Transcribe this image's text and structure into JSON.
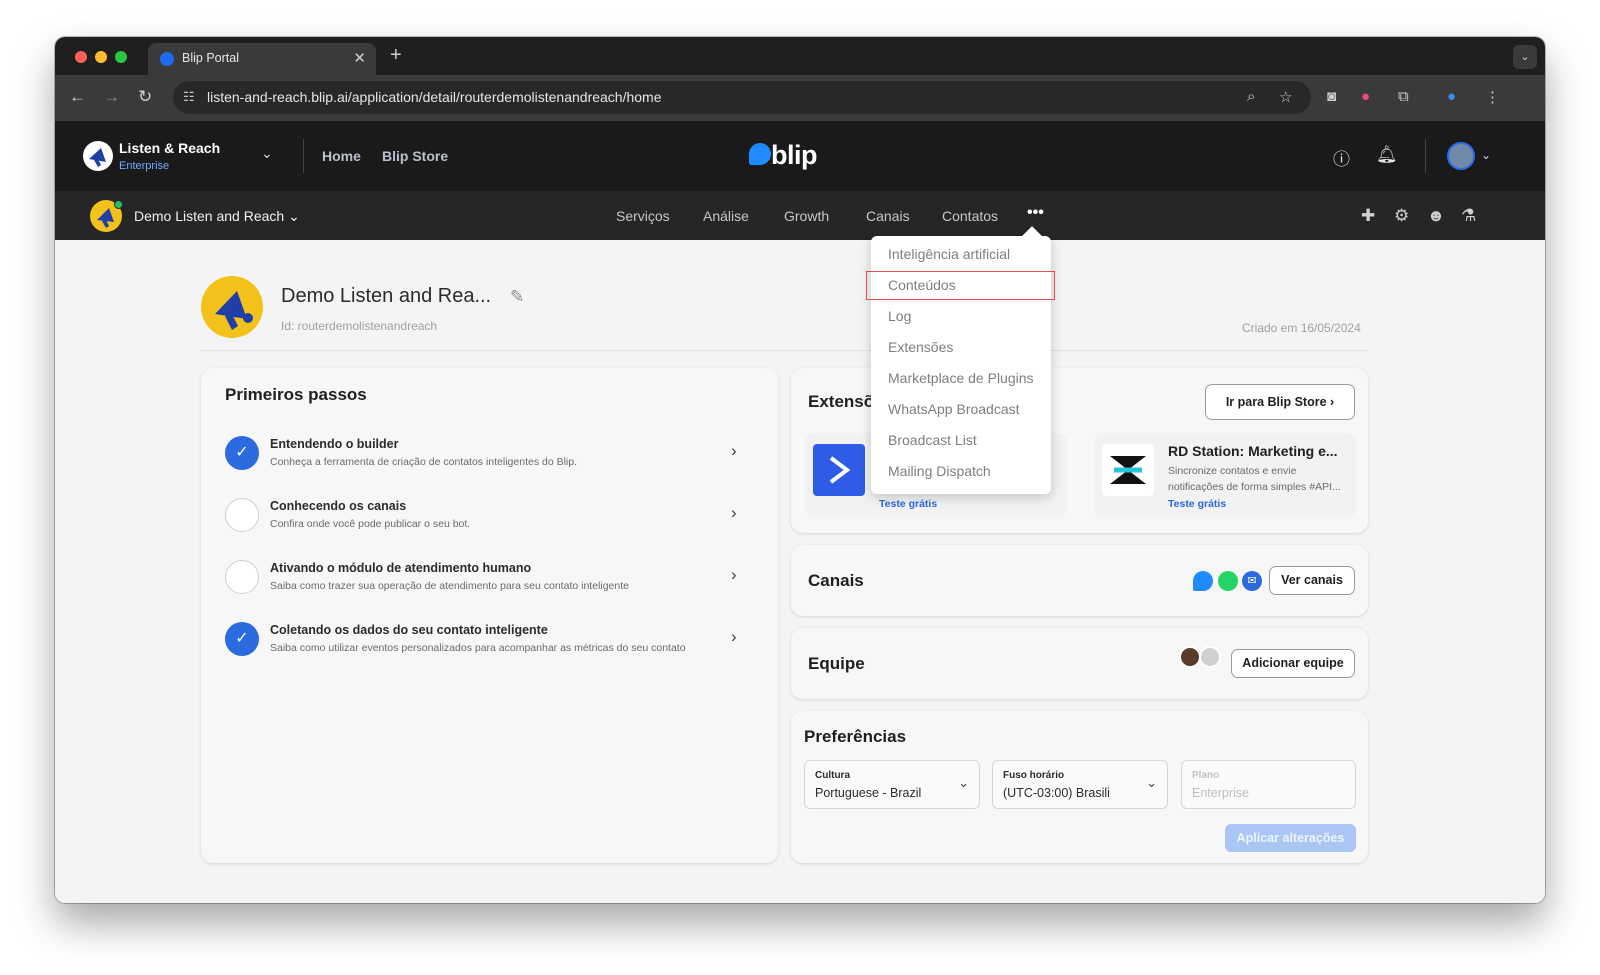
{
  "browser": {
    "tab_title": "Blip Portal",
    "tab_close": "✕",
    "new_tab": "+",
    "tabs_menu": "⌄",
    "url": "listen-and-reach.blip.ai/application/detail/routerdemolistenandreach/home"
  },
  "header": {
    "org_name": "Listen & Reach",
    "org_plan": "Enterprise",
    "links": [
      "Home",
      "Blip Store"
    ],
    "logo_text": "blip"
  },
  "bot_bar": {
    "bot_name": "Demo Listen and Reach",
    "nav": [
      "Serviços",
      "Análise",
      "Growth",
      "Canais",
      "Contatos"
    ],
    "more": "•••"
  },
  "menu": {
    "items": [
      "Inteligência artificial",
      "Conteúdos",
      "Log",
      "Extensões",
      "Marketplace de Plugins",
      "WhatsApp Broadcast",
      "Broadcast List",
      "Mailing Dispatch"
    ],
    "highlighted": "Conteúdos"
  },
  "hero": {
    "name": "Demo Listen and Rea...",
    "id": "Id: routerdemolistenandreach",
    "created": "Criado em  16/05/2024"
  },
  "steps": {
    "title": "Primeiros passos",
    "items": [
      {
        "title": "Entendendo o builder",
        "desc": "Conheça a ferramenta de criação de contatos inteligentes do Blip.",
        "done": true
      },
      {
        "title": "Conhecendo os canais",
        "desc": "Confira onde você pode publicar o seu bot.",
        "done": false
      },
      {
        "title": "Ativando o módulo de atendimento humano",
        "desc": "Saiba como trazer sua operação de atendimento para seu contato inteligente",
        "done": false
      },
      {
        "title": "Coletando os dados do seu contato inteligente",
        "desc": "Saiba como utilizar eventos personalizados para acompanhar as métricas do seu contato",
        "done": true
      }
    ]
  },
  "extensions": {
    "title": "Extensõ",
    "store_button": "Ir para Blip Store",
    "items": [
      {
        "name": "",
        "desc": "",
        "trial": "Teste grátis"
      },
      {
        "name": "RD Station: Marketing e...",
        "desc": "Sincronize contatos e envie notificações de forma simples #API...",
        "trial": "Teste grátis"
      }
    ]
  },
  "channels": {
    "title": "Canais",
    "button": "Ver canais"
  },
  "team": {
    "title": "Equipe",
    "button": "Adicionar equipe"
  },
  "preferences": {
    "title": "Preferências",
    "culture_label": "Cultura",
    "culture_value": "Portuguese - Brazil",
    "timezone_label": "Fuso horário",
    "timezone_value": "(UTC-03:00) Brasili",
    "plan_label": "Plano",
    "plan_value": "Enterprise",
    "apply_button": "Aplicar alterações"
  },
  "colors": {
    "accent": "#2c6ae0",
    "bot_yellow": "#f2c21b",
    "whatsapp": "#25d366",
    "highlight_border": "#e74c4c"
  }
}
